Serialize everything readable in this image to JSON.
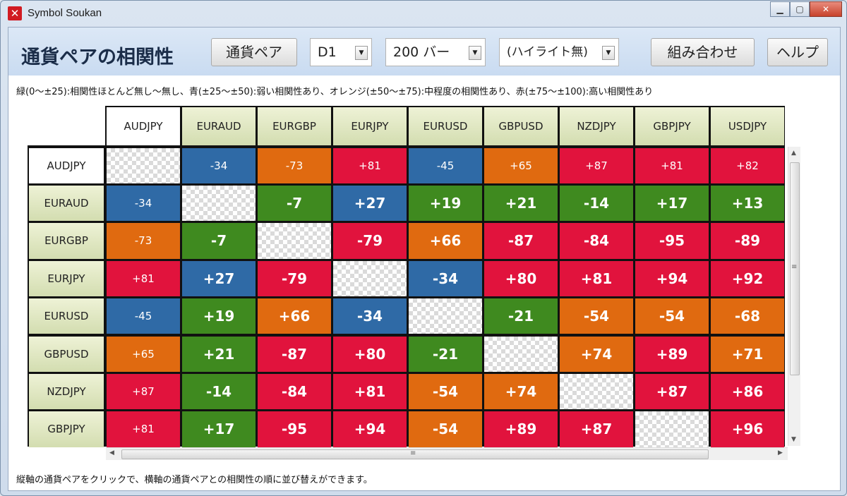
{
  "window": {
    "title": "Symbol Soukan"
  },
  "toolbar": {
    "heading": "通貨ペアの相関性",
    "pair_button": "通貨ペア",
    "timeframe": "D1",
    "bars": "200 バー",
    "highlight": "(ハイライト無)",
    "combo_button": "組み合わせ",
    "help_button": "ヘルプ"
  },
  "legend_text": "緑(0〜±25):相関性ほとんど無し〜無し、青(±25〜±50):弱い相関性あり、オレンジ(±50〜±75):中程度の相関性あり、赤(±75〜±100):高い相関性あり",
  "footer_text": "縦軸の通貨ペアをクリックで、横軸の通貨ペアとの相関性の順に並び替えができます。",
  "colors": {
    "green": "#3f8a1f",
    "blue": "#2f6aa6",
    "orange": "#e06a10",
    "red": "#e1133d"
  },
  "matrix": {
    "columns": [
      "AUDJPY",
      "EURAUD",
      "EURGBP",
      "EURJPY",
      "EURUSD",
      "GBPUSD",
      "NZDJPY",
      "GBPJPY",
      "USDJPY"
    ],
    "rows": [
      {
        "label": "AUDJPY",
        "values": [
          "",
          "-34",
          "-73",
          "+81",
          "-45",
          "+65",
          "+87",
          "+81",
          "+82"
        ]
      },
      {
        "label": "EURAUD",
        "values": [
          "-34",
          "",
          "-7",
          "+27",
          "+19",
          "+21",
          "-14",
          "+17",
          "+13"
        ]
      },
      {
        "label": "EURGBP",
        "values": [
          "-73",
          "-7",
          "",
          "-79",
          "+66",
          "-87",
          "-84",
          "-95",
          "-89"
        ]
      },
      {
        "label": "EURJPY",
        "values": [
          "+81",
          "+27",
          "-79",
          "",
          "-34",
          "+80",
          "+81",
          "+94",
          "+92"
        ]
      },
      {
        "label": "EURUSD",
        "values": [
          "-45",
          "+19",
          "+66",
          "-34",
          "",
          "-21",
          "-54",
          "-54",
          "-68"
        ]
      },
      {
        "label": "GBPUSD",
        "values": [
          "+65",
          "+21",
          "-87",
          "+80",
          "-21",
          "",
          "+74",
          "+89",
          "+71"
        ]
      },
      {
        "label": "NZDJPY",
        "values": [
          "+87",
          "-14",
          "-84",
          "+81",
          "-54",
          "+74",
          "",
          "+87",
          "+86"
        ]
      },
      {
        "label": "GBPJPY",
        "values": [
          "+81",
          "+17",
          "-95",
          "+94",
          "-54",
          "+89",
          "+87",
          "",
          "+96"
        ]
      }
    ]
  },
  "scrollbar": {
    "grip": "≡"
  }
}
